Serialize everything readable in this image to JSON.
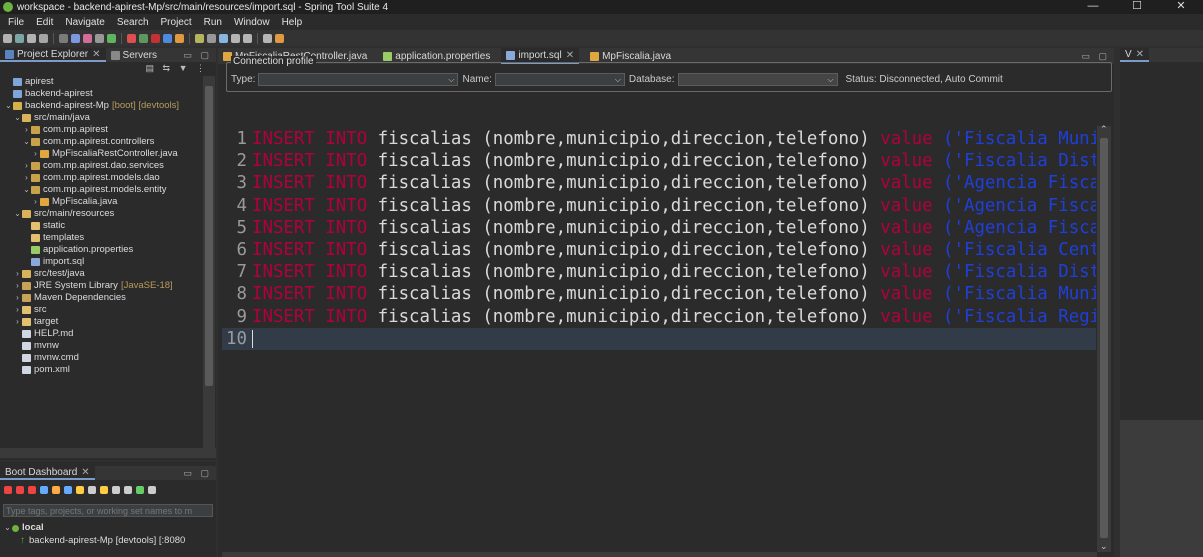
{
  "window": {
    "title": "workspace - backend-apirest-Mp/src/main/resources/import.sql - Spring Tool Suite 4",
    "controls": [
      "—",
      "☐",
      "✕"
    ]
  },
  "menu": [
    "File",
    "Edit",
    "Navigate",
    "Search",
    "Project",
    "Run",
    "Window",
    "Help"
  ],
  "left_pane": {
    "tabs": [
      {
        "label": "Project Explorer",
        "icon": "project-explorer-icon",
        "close": "✕"
      },
      {
        "label": "Servers",
        "icon": "servers-icon"
      }
    ],
    "tree": [
      {
        "indent": 0,
        "arrow": "",
        "icon": "project-icon",
        "label": "apirest"
      },
      {
        "indent": 0,
        "arrow": "",
        "icon": "project-icon",
        "label": "backend-apirest"
      },
      {
        "indent": 0,
        "arrow": "⌄",
        "icon": "boot-project-icon",
        "label": "backend-apirest-Mp",
        "suffix": "[boot] [devtools]"
      },
      {
        "indent": 1,
        "arrow": "⌄",
        "icon": "source-folder-icon",
        "label": "src/main/java"
      },
      {
        "indent": 2,
        "arrow": "›",
        "icon": "package-icon",
        "label": "com.mp.apirest"
      },
      {
        "indent": 2,
        "arrow": "⌄",
        "icon": "package-icon",
        "label": "com.mp.apirest.controllers"
      },
      {
        "indent": 3,
        "arrow": "›",
        "icon": "java-file-icon",
        "label": "MpFiscaliaRestController.java"
      },
      {
        "indent": 2,
        "arrow": "›",
        "icon": "package-icon",
        "label": "com.mp.apirest.dao.services"
      },
      {
        "indent": 2,
        "arrow": "›",
        "icon": "package-icon",
        "label": "com.mp.apirest.models.dao"
      },
      {
        "indent": 2,
        "arrow": "⌄",
        "icon": "package-icon",
        "label": "com.mp.apirest.models.entity"
      },
      {
        "indent": 3,
        "arrow": "›",
        "icon": "java-file-icon",
        "label": "MpFiscalia.java"
      },
      {
        "indent": 1,
        "arrow": "⌄",
        "icon": "source-folder-icon",
        "label": "src/main/resources"
      },
      {
        "indent": 2,
        "arrow": "",
        "icon": "folder-icon",
        "label": "static"
      },
      {
        "indent": 2,
        "arrow": "",
        "icon": "folder-icon",
        "label": "templates"
      },
      {
        "indent": 2,
        "arrow": "",
        "icon": "properties-file-icon",
        "label": "application.properties"
      },
      {
        "indent": 2,
        "arrow": "",
        "icon": "sql-file-icon",
        "label": "import.sql"
      },
      {
        "indent": 1,
        "arrow": "›",
        "icon": "source-folder-icon",
        "label": "src/test/java"
      },
      {
        "indent": 1,
        "arrow": "›",
        "icon": "library-icon",
        "label": "JRE System Library",
        "suffix": "[JavaSE-18]"
      },
      {
        "indent": 1,
        "arrow": "›",
        "icon": "library-icon",
        "label": "Maven Dependencies"
      },
      {
        "indent": 1,
        "arrow": "›",
        "icon": "folder-icon",
        "label": "src"
      },
      {
        "indent": 1,
        "arrow": "›",
        "icon": "folder-icon",
        "label": "target"
      },
      {
        "indent": 1,
        "arrow": "",
        "icon": "file-icon",
        "label": "HELP.md"
      },
      {
        "indent": 1,
        "arrow": "",
        "icon": "file-icon",
        "label": "mvnw"
      },
      {
        "indent": 1,
        "arrow": "",
        "icon": "file-icon",
        "label": "mvnw.cmd"
      },
      {
        "indent": 1,
        "arrow": "",
        "icon": "file-icon",
        "label": "pom.xml"
      }
    ]
  },
  "boot_dashboard": {
    "tab": "Boot Dashboard",
    "close": "✕",
    "filter_placeholder": "Type tags, projects, or working set names to m",
    "group": "local",
    "app": "backend-apirest-Mp [devtools] [:8080"
  },
  "editor": {
    "tabs": [
      {
        "label": "MpFiscaliaRestController.java",
        "icon": "java-file-icon",
        "active": false
      },
      {
        "label": "application.properties",
        "icon": "properties-file-icon",
        "active": false
      },
      {
        "label": "import.sql",
        "icon": "sql-file-icon",
        "active": true,
        "close": "✕"
      },
      {
        "label": "MpFiscalia.java",
        "icon": "java-file-icon",
        "active": false
      }
    ],
    "connection": {
      "legend": "Connection profile",
      "type_label": "Type:",
      "name_label": "Name:",
      "database_label": "Database:",
      "status": "Status: Disconnected, Auto Commit"
    },
    "lines": [
      {
        "n": "1",
        "kw": "INSERT INTO",
        "body": " fiscalias (nombre,municipio,direccion,telefono) ",
        "kw2": "value",
        "str": " ('Fiscalia Municip"
      },
      {
        "n": "2",
        "kw": "INSERT INTO",
        "body": " fiscalias (nombre,municipio,direccion,telefono) ",
        "kw2": "value",
        "str": " ('Fiscalia Distrit"
      },
      {
        "n": "3",
        "kw": "INSERT INTO",
        "body": " fiscalias (nombre,municipio,direccion,telefono) ",
        "kw2": "value",
        "str": " ('Agencia Fiscal d"
      },
      {
        "n": "4",
        "kw": "INSERT INTO",
        "body": " fiscalias (nombre,municipio,direccion,telefono) ",
        "kw2": "value",
        "str": " ('Agencia Fiscal d"
      },
      {
        "n": "5",
        "kw": "INSERT INTO",
        "body": " fiscalias (nombre,municipio,direccion,telefono) ",
        "kw2": "value",
        "str": " ('Agencia Fiscal d"
      },
      {
        "n": "6",
        "kw": "INSERT INTO",
        "body": " fiscalias (nombre,municipio,direccion,telefono) ",
        "kw2": "value",
        "str": " ('Fiscalia Central"
      },
      {
        "n": "7",
        "kw": "INSERT INTO",
        "body": " fiscalias (nombre,municipio,direccion,telefono) ",
        "kw2": "value",
        "str": " ('Fiscalia Distrit"
      },
      {
        "n": "8",
        "kw": "INSERT INTO",
        "body": " fiscalias (nombre,municipio,direccion,telefono) ",
        "kw2": "value",
        "str": " ('Fiscalia Municip"
      },
      {
        "n": "9",
        "kw": "INSERT INTO",
        "body": " fiscalias (nombre,municipio,direccion,telefono) ",
        "kw2": "value",
        "str": " ('Fiscalia Regiona"
      },
      {
        "n": "10",
        "kw": "",
        "body": "",
        "kw2": "",
        "str": ""
      }
    ]
  },
  "right_pane": {
    "tab": "V",
    "close": "✕"
  },
  "colors": {
    "keyword": "#b1003c",
    "string": "#1f3fd9",
    "accent": "#7a9cc6"
  }
}
